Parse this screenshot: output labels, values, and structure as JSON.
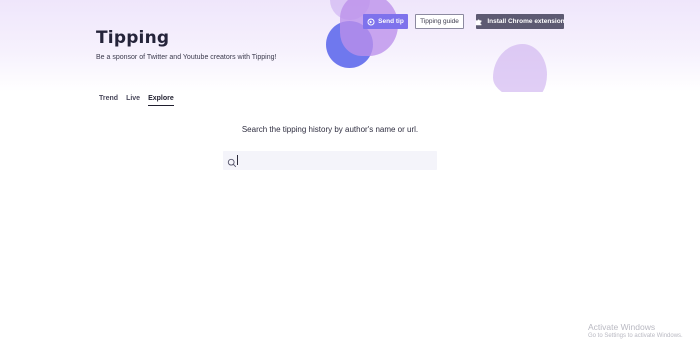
{
  "header": {
    "title": "Tipping",
    "subtitle": "Be a sponsor of Twitter and Youtube creators with Tipping!"
  },
  "buttons": {
    "send_tip": {
      "label": "Send tip",
      "icon": "send-tip-icon"
    },
    "tipping_guide": {
      "label": "Tipping guide"
    },
    "install_extension": {
      "label": "Install Chrome extension",
      "icon": "puzzle-icon"
    }
  },
  "tabs": [
    {
      "label": "Trend",
      "active": false
    },
    {
      "label": "Live",
      "active": false
    },
    {
      "label": "Explore",
      "active": true
    }
  ],
  "search": {
    "prompt": "Search the tipping history by author's name or url.",
    "value": "",
    "placeholder": "",
    "icon": "search-icon"
  },
  "watermark": {
    "title": "Activate Windows",
    "subtitle": "Go to Settings to activate Windows."
  },
  "colors": {
    "accent": "#7e72ec",
    "extension_button": "#5d5a72",
    "hero_background": "#efe6fb",
    "search_background": "#f4f4fa"
  }
}
